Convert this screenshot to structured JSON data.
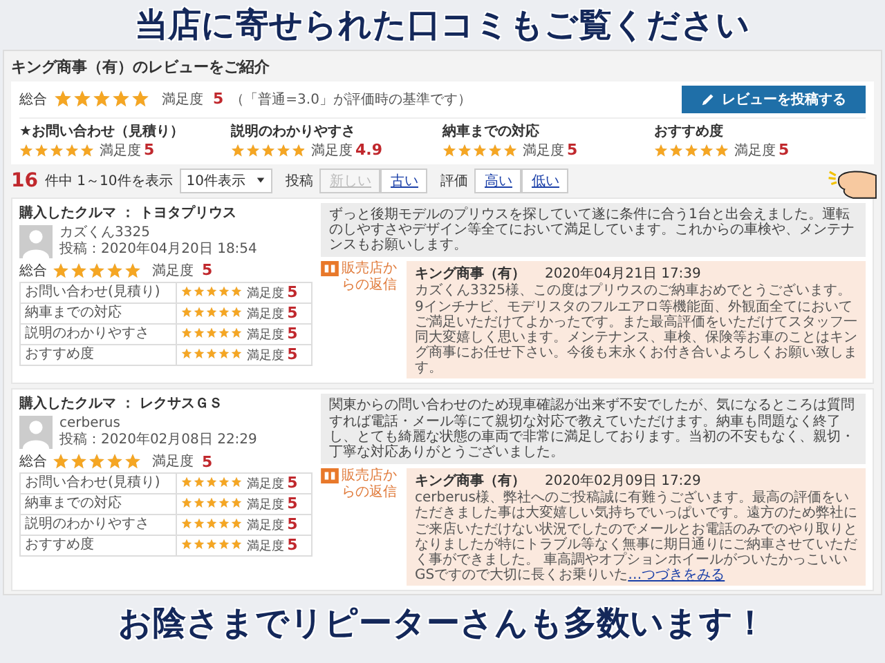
{
  "headline": "当店に寄せられた口コミもご覧ください",
  "page": {
    "title": "キング商事（有）のレビューをご紹介",
    "overall": {
      "label": "総合",
      "stars": 5,
      "score_label": "満足度",
      "score": "5",
      "note": "（「普通=3.0」が評価時の基準です）"
    },
    "post_button": "レビューを投稿する",
    "categories": [
      {
        "label": "★お問い合わせ（見積り）",
        "stars": 5,
        "score_label": "満足度",
        "score": "5"
      },
      {
        "label": "説明のわかりやすさ",
        "stars": 4.9,
        "score_label": "満足度",
        "score": "4.9"
      },
      {
        "label": "納車までの対応",
        "stars": 5,
        "score_label": "満足度",
        "score": "5"
      },
      {
        "label": "おすすめ度",
        "stars": 5,
        "score_label": "満足度",
        "score": "5"
      }
    ],
    "count": "16",
    "count_text": "件中 1～10件を表示",
    "per_page": "10件表示",
    "sort_groups": [
      {
        "label": "投稿",
        "options": [
          {
            "label": "新しい",
            "selected": true
          },
          {
            "label": "古い",
            "selected": false
          }
        ]
      },
      {
        "label": "評価",
        "options": [
          {
            "label": "高い",
            "selected": false
          },
          {
            "label": "低い",
            "selected": false
          }
        ]
      }
    ],
    "reviews": [
      {
        "car": "購入したクルマ ： トヨタプリウス",
        "user": "カズくん3325",
        "posted": "投稿：2020年04月20日 18:54",
        "overall_label": "総合",
        "stars": 5,
        "score_label": "満足度",
        "score": "5",
        "ratings": [
          {
            "label": "お問い合わせ(見積り)",
            "stars": 5,
            "score_label": "満足度",
            "score": "5"
          },
          {
            "label": "納車までの対応",
            "stars": 5,
            "score_label": "満足度",
            "score": "5"
          },
          {
            "label": "説明のわかりやすさ",
            "stars": 5,
            "score_label": "満足度",
            "score": "5"
          },
          {
            "label": "おすすめ度",
            "stars": 5,
            "score_label": "満足度",
            "score": "5"
          }
        ],
        "comment": "ずっと後期モデルのプリウスを探していて遂に条件に合う1台と出会えました。運転のしやすさやデザイン等全てにおいて満足しています。これからの車検や、メンテナンスもお願いします。",
        "reply_label": "販売店からの返信",
        "reply": {
          "author": "キング商事（有）",
          "date": "2020年04月21日 17:39",
          "text": "カズくん3325様、この度はプリウスのご納車おめでとうございます。9インチナビ、モデリスタのフルエアロ等機能面、外観面全てにおいてご満足いただけてよかったです。また最高評価をいただけてスタッフ一同大変嬉しく思います。メンテナンス、車検、保険等お車のことはキング商事にお任せ下さい。今後も末永くお付き合いよろしくお願い致します。"
        }
      },
      {
        "car": "購入したクルマ ： レクサスＧＳ",
        "user": "cerberus",
        "posted": "投稿：2020年02月08日 22:29",
        "overall_label": "総合",
        "stars": 5,
        "score_label": "満足度",
        "score": "5",
        "ratings": [
          {
            "label": "お問い合わせ(見積り)",
            "stars": 5,
            "score_label": "満足度",
            "score": "5"
          },
          {
            "label": "納車までの対応",
            "stars": 5,
            "score_label": "満足度",
            "score": "5"
          },
          {
            "label": "説明のわかりやすさ",
            "stars": 5,
            "score_label": "満足度",
            "score": "5"
          },
          {
            "label": "おすすめ度",
            "stars": 5,
            "score_label": "満足度",
            "score": "5"
          }
        ],
        "comment": "関東からの問い合わせのため現車確認が出来ず不安でしたが、気になるところは質問すれば電話・メール等にて親切な対応で教えていただけます。納車も問題なく終了し、とても綺麗な状態の車両で非常に満足しております。当初の不安もなく、親切・丁寧な対応ありがとうございました。",
        "reply_label": "販売店からの返信",
        "reply": {
          "author": "キング商事（有）",
          "date": "2020年02月09日 17:29",
          "text": "cerberus様、弊社へのご投稿誠に有難うございます。最高の評価をいただきました事は大変嬉しい気持ちでいっぱいです。遠方のため弊社にご来店いただけない状況でしたのでメールとお電話のみでのやり取りとなりましたが特にトラブル等なく無事に期日通りにご納車させていただく事ができました。 車高調やオプションホイールがついたかっこいいGSですので大切に長くお乗りいた",
          "more_link": "…つづきをみる"
        }
      }
    ]
  },
  "footer_headline": "お陰さまでリピーターさんも多数います！"
}
